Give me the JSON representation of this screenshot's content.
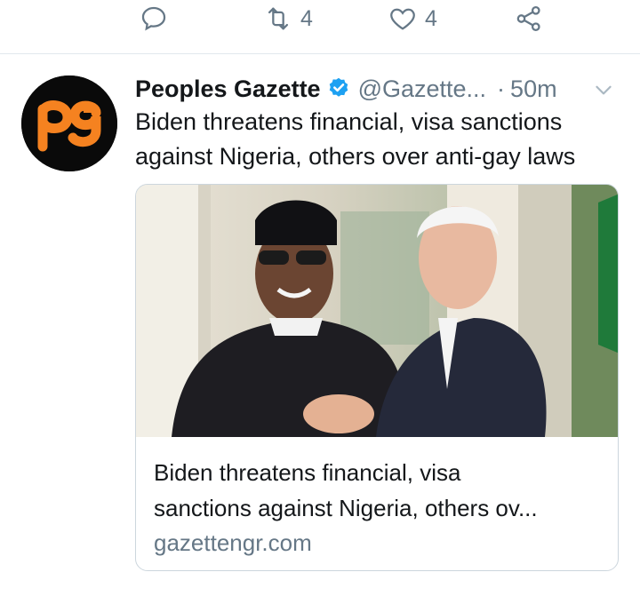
{
  "actions": {
    "reply": {
      "icon": "reply-icon"
    },
    "retweet": {
      "icon": "retweet-icon",
      "count": "4"
    },
    "like": {
      "icon": "heart-icon",
      "count": "4"
    },
    "share": {
      "icon": "share-icon"
    }
  },
  "tweet": {
    "author": "Peoples Gazette",
    "verified": true,
    "handle": "@Gazette...",
    "separator": "·",
    "time": "50m",
    "text_line1": "Biden threatens financial, visa sanctions",
    "text_line2": "against Nigeria, others over anti-gay laws",
    "avatar_text": "pg",
    "colors": {
      "brand_orange": "#f58220",
      "verified_blue": "#1da1f2",
      "secondary_text": "#657786"
    }
  },
  "card": {
    "title_line1": "Biden threatens financial, visa",
    "title_line2": "sanctions against Nigeria, others ov...",
    "domain": "gazettengr.com",
    "image": {
      "icon": "news-photo"
    }
  }
}
